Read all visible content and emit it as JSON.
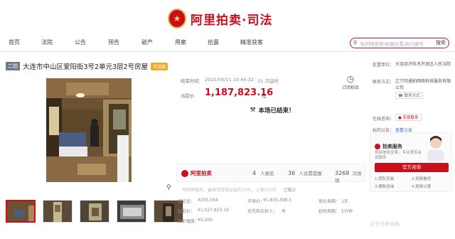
{
  "header": {
    "brand": "阿里拍卖·司法"
  },
  "nav": {
    "items": [
      "首页",
      "法院",
      "公告",
      "预告",
      "破产",
      "用案",
      "拾露",
      "精准获客"
    ]
  },
  "search": {
    "placeholder": "标的物名称/标题位置/执行案号"
  },
  "lot": {
    "round_tag": "二拍",
    "title": "大连市中山区爱阳街3号2单元3层2号房屋",
    "badge": "可贷款"
  },
  "bidding": {
    "end_time_label": "结束时间",
    "end_time": "2021/09/11 10:44:32",
    "extensions": "31 次延时",
    "current_price_label": "当前价",
    "current_price": "1,187,823.16",
    "price_unit": "元",
    "remind_label": "订阅拍品",
    "ended_text": "本场已结束！"
  },
  "stats": {
    "brand": "阿里拍卖",
    "signups": "4",
    "signups_label": "人报名",
    "reminders": "36",
    "reminders_label": "人设置提醒",
    "views": "3268",
    "views_label": "次围观"
  },
  "warning": {
    "text": "可转续报名，最高可贷保证金的70%，上限100万",
    "tail": "已截止"
  },
  "details": {
    "deposit_label": "保证金：",
    "deposit": "¥205,564",
    "market_label": "市场价：",
    "market": "¥1,835,398.5",
    "cycle_label": "竞价周期：",
    "cycle": "1天",
    "start_label": "起拍价：",
    "start": "¥1,027,823.16",
    "priority_label": "优先购买权人：",
    "priority": "有",
    "ext_label": "延时周期：",
    "ext": "5分钟",
    "increment_label": "加价幅度：",
    "increment": "¥5,000"
  },
  "sidebar": {
    "court_label": "处置单位：",
    "court": "大连经济技术开发区人民法院",
    "contact_label": "联系方式：",
    "contact": "辽宁冈通拍网络科技服务有限公司",
    "contact_btn": "联系方式",
    "consult_label": "在线咨询：",
    "consult_btn": "实现联系",
    "notice_label": "标的公告：",
    "notice_link": "查看公告",
    "service_title": "拍卖服务",
    "service_desc": "竞拍信息全掌，专业竞答会员服务",
    "service_btn": "官方咨询",
    "steps": [
      "1.团队安装",
      "2.视频看房",
      "3.赛购咨询",
      "4.税费计算"
    ]
  },
  "watermark": "辽宁日发拍卖"
}
